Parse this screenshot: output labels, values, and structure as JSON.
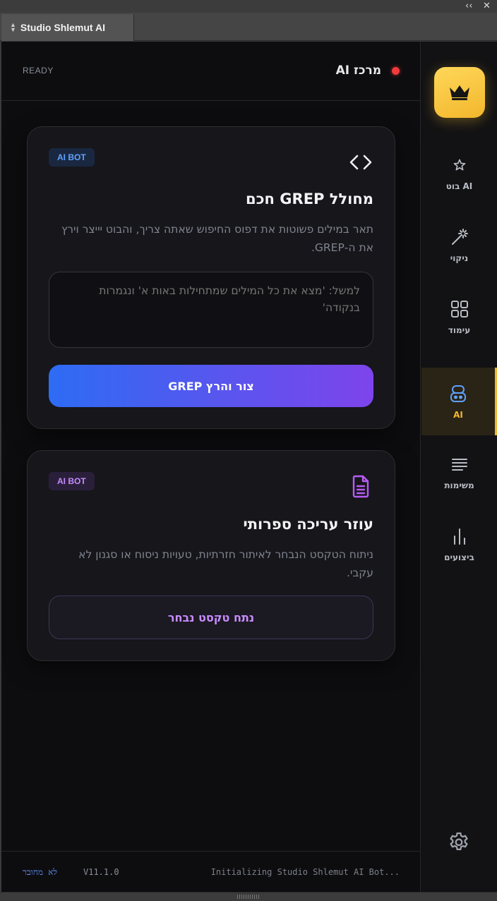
{
  "window": {
    "tab_title": "Studio Shlemut AI",
    "collapse_glyph": "‹‹",
    "close_glyph": "✕"
  },
  "header": {
    "status": "READY",
    "hub_title": "מרכז AI",
    "recording_color": "#ef3b3b"
  },
  "cards": [
    {
      "badge": "AI BOT",
      "icon": "code-brackets-icon",
      "title": "מחולל GREP חכם",
      "description": "תאר במילים פשוטות את דפוס החיפוש שאתה צריך, והבוט יייצר וירץ את ה-GREP.",
      "input_placeholder": "למשל: 'מצא את כל המילים שמתחילות באות א' ונגמרות בנקודה'",
      "input_value": "",
      "button_label": "צור והרץ GREP"
    },
    {
      "badge": "AI BOT",
      "icon": "document-icon",
      "title": "עוזר עריכה ספרותי",
      "description": "ניתוח הטקסט הנבחר לאיתור חזרתיות, טעויות ניסוח או סגנון לא עקבי.",
      "button_label": "נתח טקסט נבחר"
    }
  ],
  "footer": {
    "connection_status": "לא מחובר",
    "version": "V11.1.0",
    "log_message": "Initializing Studio Shlemut AI Bot..."
  },
  "sidebar": {
    "logo_icon": "crown-icon",
    "items": [
      {
        "label": "AI בוט",
        "icon": "star-icon",
        "active": false
      },
      {
        "label": "ניקוי",
        "icon": "magic-wand-icon",
        "active": false
      },
      {
        "label": "עימוד",
        "icon": "grid-icon",
        "active": false
      },
      {
        "label": "AI",
        "icon": "robot-icon",
        "active": true
      },
      {
        "label": "משימות",
        "icon": "tasks-icon",
        "active": false
      },
      {
        "label": "ביצועים",
        "icon": "bar-chart-icon",
        "active": false
      }
    ],
    "settings_icon": "gear-icon"
  },
  "colors": {
    "accent_gold": "#f2b72c",
    "accent_blue": "#2d6cf4",
    "accent_purple": "#7e44ec",
    "background": "#0d0d0f"
  }
}
